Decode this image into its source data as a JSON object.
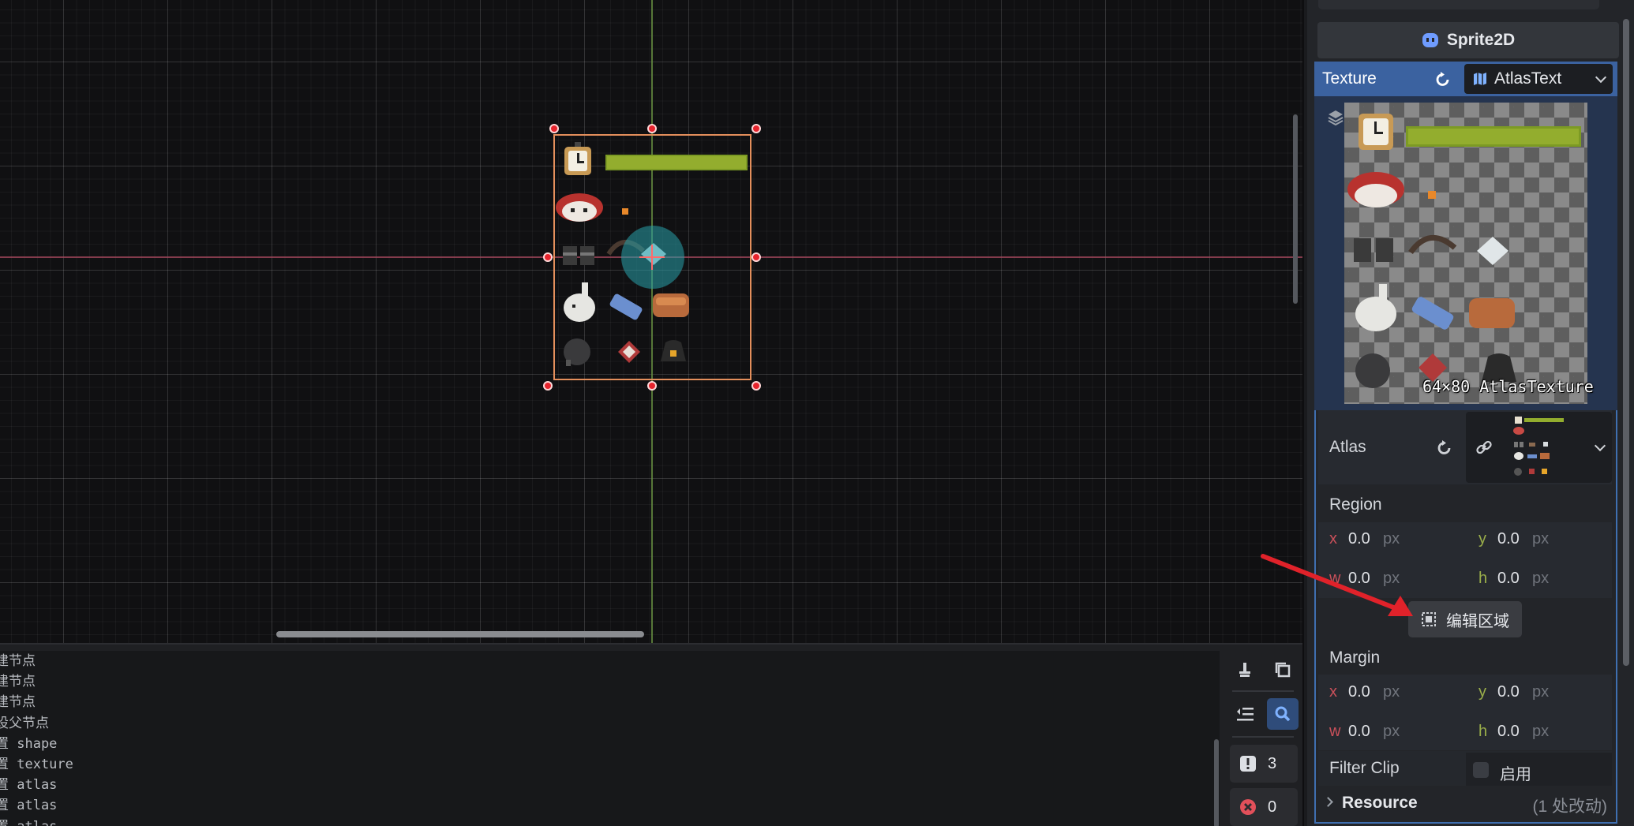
{
  "node": {
    "type_name": "Sprite2D"
  },
  "texture": {
    "label": "Texture",
    "resource_type": "AtlasText",
    "preview_caption": "64×80 AtlasTexture"
  },
  "atlas": {
    "label": "Atlas"
  },
  "region": {
    "label": "Region",
    "x": {
      "label": "x",
      "value": "0.0",
      "unit": "px"
    },
    "y": {
      "label": "y",
      "value": "0.0",
      "unit": "px"
    },
    "w": {
      "label": "w",
      "value": "0.0",
      "unit": "px"
    },
    "h": {
      "label": "h",
      "value": "0.0",
      "unit": "px"
    },
    "edit_button": "编辑区域"
  },
  "margin": {
    "label": "Margin",
    "x": {
      "label": "x",
      "value": "0.0",
      "unit": "px"
    },
    "y": {
      "label": "y",
      "value": "0.0",
      "unit": "px"
    },
    "w": {
      "label": "w",
      "value": "0.0",
      "unit": "px"
    },
    "h": {
      "label": "h",
      "value": "0.0",
      "unit": "px"
    }
  },
  "filter_clip": {
    "label": "Filter Clip",
    "checkbox_label": "启用",
    "checked": false
  },
  "resource": {
    "label": "Resource",
    "changes": "(1 处改动)"
  },
  "log": {
    "lines": [
      "建节点",
      "建节点",
      "建节点",
      "设父节点",
      "置 shape",
      "置 texture",
      "置 atlas",
      "置 atlas",
      "置 atlas"
    ],
    "warning_count": "3",
    "error_count": "0"
  },
  "colors": {
    "accent": "#3b62a0",
    "axis_x": "#a8485e",
    "axis_y": "#6e9a46",
    "selection": "#e48f5c",
    "handle": "#e6242d",
    "annotation_arrow": "#e0222a"
  },
  "icons": [
    "sprite-node-icon",
    "revert-icon",
    "atlas-texture-icon",
    "chevron-down-icon",
    "layers-icon",
    "link-icon",
    "region-edit-icon",
    "clear-icon",
    "copy-icon",
    "collapse-icon",
    "search-icon",
    "warning-icon",
    "error-icon"
  ]
}
